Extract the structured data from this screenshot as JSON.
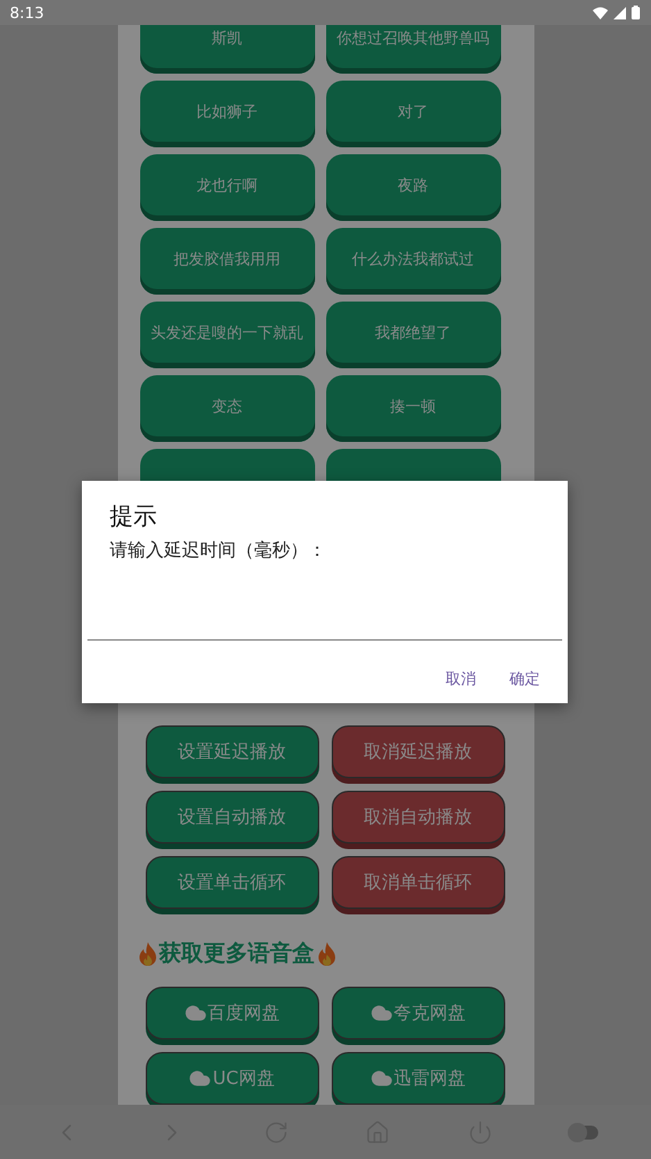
{
  "status_bar": {
    "time": "8:13"
  },
  "voice_buttons": [
    {
      "label": "斯凯"
    },
    {
      "label": "你想过召唤其他野兽吗"
    },
    {
      "label": "比如狮子"
    },
    {
      "label": "对了"
    },
    {
      "label": "龙也行啊"
    },
    {
      "label": "夜路"
    },
    {
      "label": "把发胶借我用用"
    },
    {
      "label": "什么办法我都试过"
    },
    {
      "label": "头发还是嗖的一下就乱"
    },
    {
      "label": "我都绝望了"
    },
    {
      "label": "变态"
    },
    {
      "label": "揍一顿"
    }
  ],
  "dialog": {
    "title": "提示",
    "message": "请输入延迟时间（毫秒）：",
    "buttons": [
      {
        "label": "取消"
      },
      {
        "label": "确定"
      }
    ]
  },
  "settings": {
    "buttons": [
      {
        "label": "设置延迟播放",
        "kind": "set"
      },
      {
        "label": "取消延迟播放",
        "kind": "cancel"
      },
      {
        "label": "设置自动播放",
        "kind": "set"
      },
      {
        "label": "取消自动播放",
        "kind": "cancel"
      },
      {
        "label": "设置单击循环",
        "kind": "set"
      },
      {
        "label": "取消单击循环",
        "kind": "cancel"
      }
    ]
  },
  "more": {
    "title": "获取更多语音盒",
    "links": [
      {
        "label": "百度网盘"
      },
      {
        "label": "夸克网盘"
      },
      {
        "label": "UC网盘"
      },
      {
        "label": "迅雷网盘"
      }
    ]
  },
  "nav_bar": {
    "toggle_on": false
  }
}
